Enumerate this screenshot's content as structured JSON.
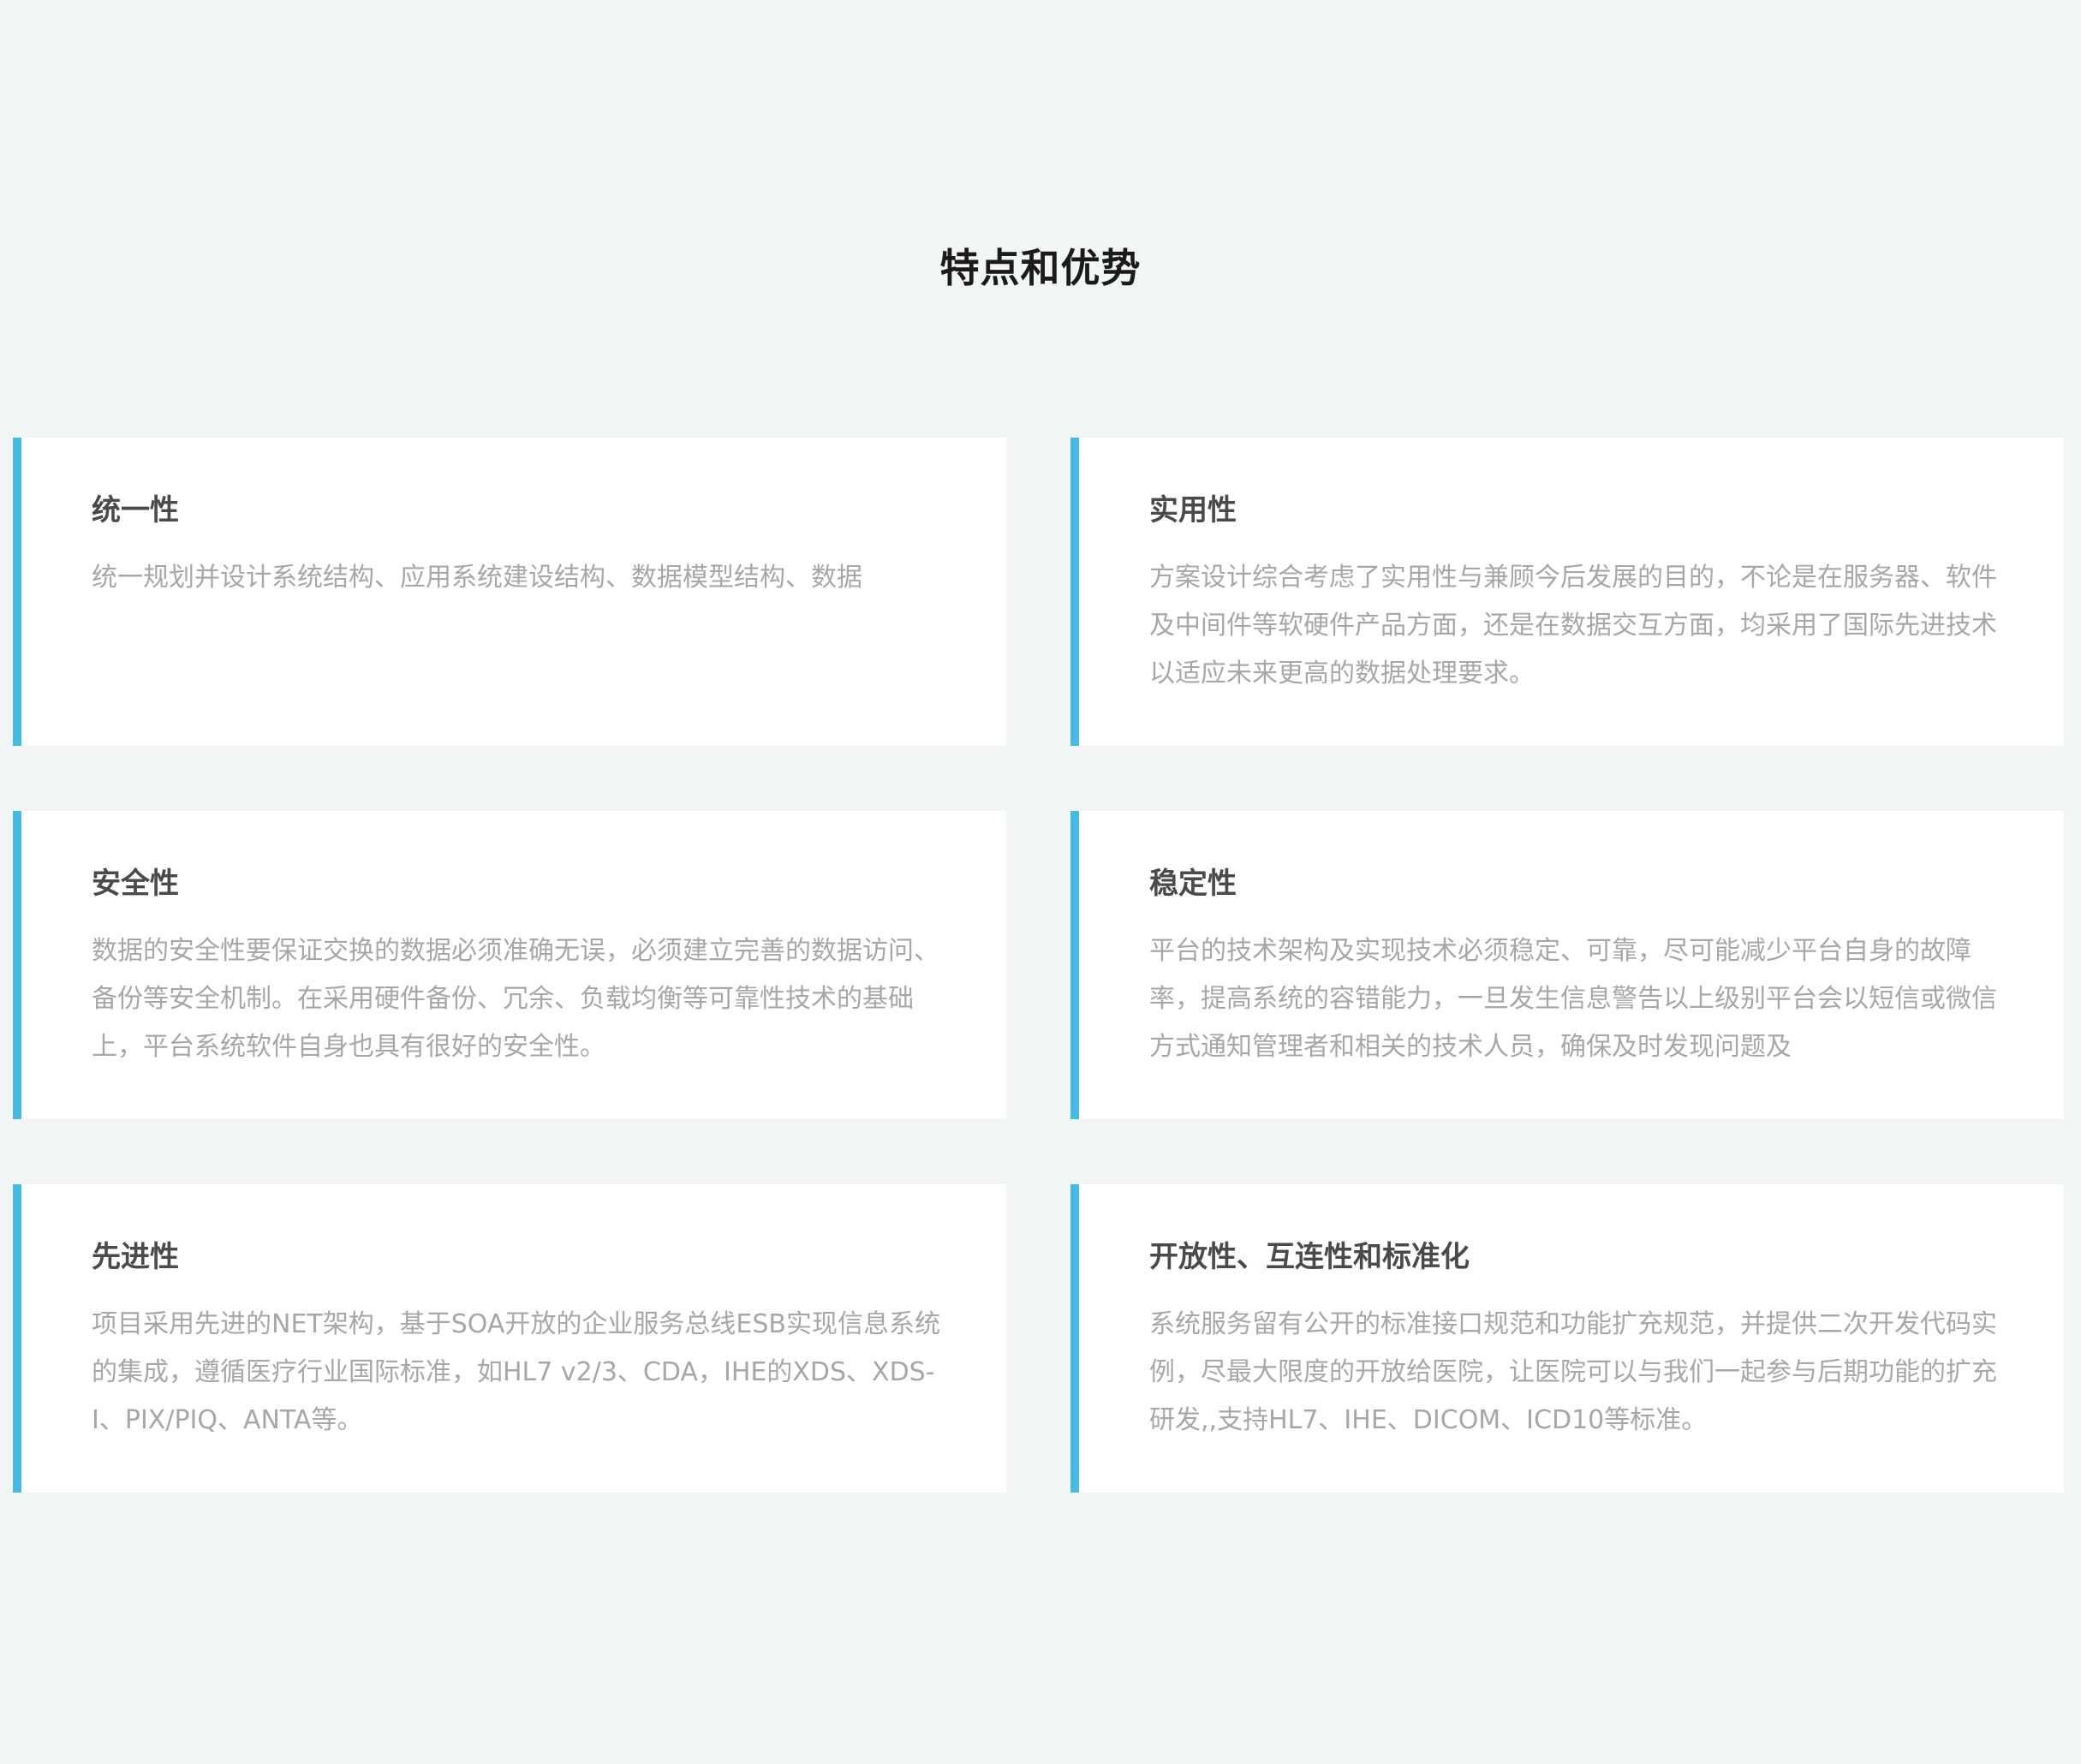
{
  "section": {
    "title": "特点和优势"
  },
  "accent_color": "#45bbe4",
  "cards": [
    {
      "title": "统一性",
      "text": "统一规划并设计系统结构、应用系统建设结构、数据模型结构、数据"
    },
    {
      "title": "实用性",
      "text": "方案设计综合考虑了实用性与兼顾今后发展的目的，不论是在服务器、软件及中间件等软硬件产品方面，还是在数据交互方面，均采用了国际先进技术以适应未来更高的数据处理要求。"
    },
    {
      "title": "安全性",
      "text": "数据的安全性要保证交换的数据必须准确无误，必须建立完善的数据访问、备份等安全机制。在采用硬件备份、冗余、负载均衡等可靠性技术的基础上，平台系统软件自身也具有很好的安全性。"
    },
    {
      "title": "稳定性",
      "text": "平台的技术架构及实现技术必须稳定、可靠，尽可能减少平台自身的故障率，提高系统的容错能力，一旦发生信息警告以上级别平台会以短信或微信方式通知管理者和相关的技术人员，确保及时发现问题及"
    },
    {
      "title": "先进性",
      "text": "项目采用先进的NET架构，基于SOA开放的企业服务总线ESB实现信息系统的集成，遵循医疗行业国际标准，如HL7 v2/3、CDA，IHE的XDS、XDS-I、PIX/PIQ、ANTA等。"
    },
    {
      "title": "开放性、互连性和标准化",
      "text": "系统服务留有公开的标准接口规范和功能扩充规范，并提供二次开发代码实例，尽最大限度的开放给医院，让医院可以与我们一起参与后期功能的扩充研发,,支持HL7、IHE、DICOM、ICD10等标准。"
    }
  ]
}
